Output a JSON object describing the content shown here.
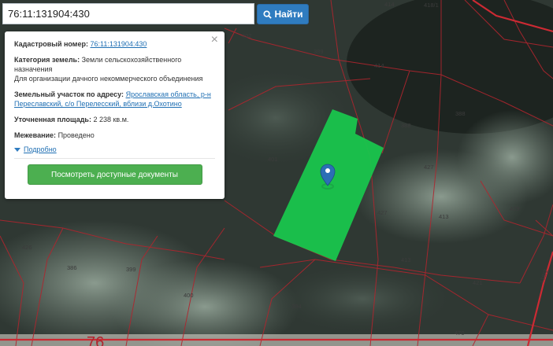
{
  "search": {
    "value": "76:11:131904:430",
    "button_label": "Найти"
  },
  "panel": {
    "cadastral_label": "Кадастровый номер:",
    "cadastral_value": "76:11:131904:430",
    "category_label": "Категория земель:",
    "category_value": "Земли сельскохозяйственного назначения",
    "purpose": "Для организации дачного некоммерческого объединения",
    "address_label": "Земельный участок по адресу:",
    "address_value": "Ярославская область, р-н Переславский, с/о Перелесский, вблизи д.Охотино",
    "area_label": "Уточненная площадь:",
    "area_value": "2 238 кв.м.",
    "survey_label": "Межевание:",
    "survey_value": "Проведено",
    "more_label": "Подробно",
    "docs_button": "Посмотреть доступные документы",
    "close": "×"
  },
  "map": {
    "parcel_labels": [
      "402",
      "389",
      "414",
      "414",
      "418/1",
      "388",
      "388",
      "427",
      "413",
      "429",
      "427",
      "401",
      "413",
      "426",
      "386",
      "399",
      "400",
      "394",
      "421",
      "470",
      "418/2"
    ],
    "district_label": "76",
    "highlight_color": "#19c54d",
    "marker_color": "#2c6fb5"
  }
}
